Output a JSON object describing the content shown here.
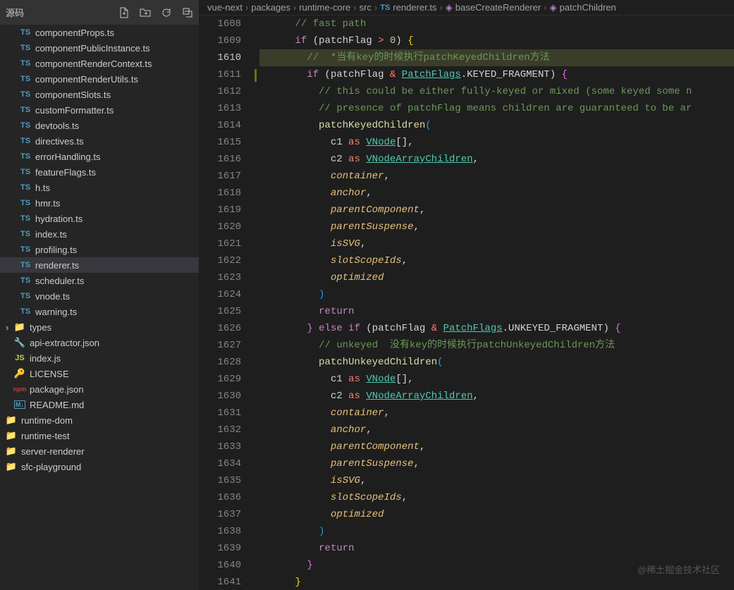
{
  "sidebar": {
    "title": "源码",
    "files": [
      {
        "name": "componentProps.ts",
        "type": "ts",
        "indent": 1
      },
      {
        "name": "componentPublicInstance.ts",
        "type": "ts",
        "indent": 1
      },
      {
        "name": "componentRenderContext.ts",
        "type": "ts",
        "indent": 1
      },
      {
        "name": "componentRenderUtils.ts",
        "type": "ts",
        "indent": 1
      },
      {
        "name": "componentSlots.ts",
        "type": "ts",
        "indent": 1
      },
      {
        "name": "customFormatter.ts",
        "type": "ts",
        "indent": 1
      },
      {
        "name": "devtools.ts",
        "type": "ts",
        "indent": 1
      },
      {
        "name": "directives.ts",
        "type": "ts",
        "indent": 1
      },
      {
        "name": "errorHandling.ts",
        "type": "ts",
        "indent": 1
      },
      {
        "name": "featureFlags.ts",
        "type": "ts",
        "indent": 1
      },
      {
        "name": "h.ts",
        "type": "ts",
        "indent": 1
      },
      {
        "name": "hmr.ts",
        "type": "ts",
        "indent": 1
      },
      {
        "name": "hydration.ts",
        "type": "ts",
        "indent": 1
      },
      {
        "name": "index.ts",
        "type": "ts",
        "indent": 1
      },
      {
        "name": "profiling.ts",
        "type": "ts",
        "indent": 1
      },
      {
        "name": "renderer.ts",
        "type": "ts",
        "indent": 1,
        "selected": true
      },
      {
        "name": "scheduler.ts",
        "type": "ts",
        "indent": 1
      },
      {
        "name": "vnode.ts",
        "type": "ts",
        "indent": 1
      },
      {
        "name": "warning.ts",
        "type": "ts",
        "indent": 1
      },
      {
        "name": "types",
        "type": "folder",
        "indent": 0,
        "chevron": true
      },
      {
        "name": "api-extractor.json",
        "type": "json",
        "indent": 0
      },
      {
        "name": "index.js",
        "type": "js",
        "indent": 0
      },
      {
        "name": "LICENSE",
        "type": "license",
        "indent": 0
      },
      {
        "name": "package.json",
        "type": "npm",
        "indent": 0
      },
      {
        "name": "README.md",
        "type": "md",
        "indent": 0
      },
      {
        "name": "runtime-dom",
        "type": "folder",
        "indent": 0
      },
      {
        "name": "runtime-test",
        "type": "folder",
        "indent": 0
      },
      {
        "name": "server-renderer",
        "type": "folder",
        "indent": 0
      },
      {
        "name": "sfc-playground",
        "type": "folder",
        "indent": 0
      }
    ]
  },
  "breadcrumb": [
    {
      "label": "vue-next",
      "icon": ""
    },
    {
      "label": "packages",
      "icon": ""
    },
    {
      "label": "runtime-core",
      "icon": ""
    },
    {
      "label": "src",
      "icon": ""
    },
    {
      "label": "renderer.ts",
      "icon": "ts"
    },
    {
      "label": "baseCreateRenderer",
      "icon": "cube"
    },
    {
      "label": "patchChildren",
      "icon": "cube"
    }
  ],
  "lines": {
    "start": 1608,
    "end": 1641,
    "current": 1610
  },
  "code": {
    "l1608": "      // fast path",
    "l1609_if": "if",
    "l1609_cond": " (patchFlag ",
    "l1609_op": ">",
    "l1609_num": " 0",
    "l1609_brace": ") {",
    "l1610": "        //  *当有key的时候执行patchKeyedChildren方法",
    "l1611_if": "if",
    "l1611_a": " (patchFlag ",
    "l1611_op": "&",
    "l1611_b": " ",
    "l1611_type": "PatchFlags",
    "l1611_c": ".KEYED_FRAGMENT) ",
    "l1611_brace": "{",
    "l1612": "          // this could be either fully-keyed or mixed (some keyed some n",
    "l1613": "          // presence of patchFlag means children are guaranteed to be ar",
    "l1614_fn": "patchKeyedChildren",
    "l1614_p": "(",
    "l1615_a": "c1 ",
    "l1615_as": "as",
    "l1615_b": " ",
    "l1615_type": "VNode",
    "l1615_c": "[],",
    "l1616_a": "c2 ",
    "l1616_as": "as",
    "l1616_b": " ",
    "l1616_type": "VNodeArrayChildren",
    "l1616_c": ",",
    "l1617": "container",
    "l1618": "anchor",
    "l1619": "parentComponent",
    "l1620": "parentSuspense",
    "l1621": "isSVG",
    "l1622": "slotScopeIds",
    "l1623": "optimized",
    "l1624": ")",
    "l1625": "return",
    "l1626_a": "} ",
    "l1626_else": "else",
    "l1626_if": " if",
    "l1626_b": " (patchFlag ",
    "l1626_op": "&",
    "l1626_c": " ",
    "l1626_type": "PatchFlags",
    "l1626_d": ".UNKEYED_FRAGMENT) ",
    "l1626_brace": "{",
    "l1627": "          // unkeyed  没有key的时候执行patchUnkeyedChildren方法",
    "l1628_fn": "patchUnkeyedChildren",
    "l1628_p": "(",
    "l1629_a": "c1 ",
    "l1629_as": "as",
    "l1629_b": " ",
    "l1629_type": "VNode",
    "l1629_c": "[],",
    "l1630_a": "c2 ",
    "l1630_as": "as",
    "l1630_b": " ",
    "l1630_type": "VNodeArrayChildren",
    "l1630_c": ",",
    "l1631": "container",
    "l1632": "anchor",
    "l1633": "parentComponent",
    "l1634": "parentSuspense",
    "l1635": "isSVG",
    "l1636": "slotScopeIds",
    "l1637": "optimized",
    "l1638": ")",
    "l1639": "return",
    "l1640": "}",
    "l1641": "}"
  },
  "watermark": "@稀土掘金技术社区"
}
